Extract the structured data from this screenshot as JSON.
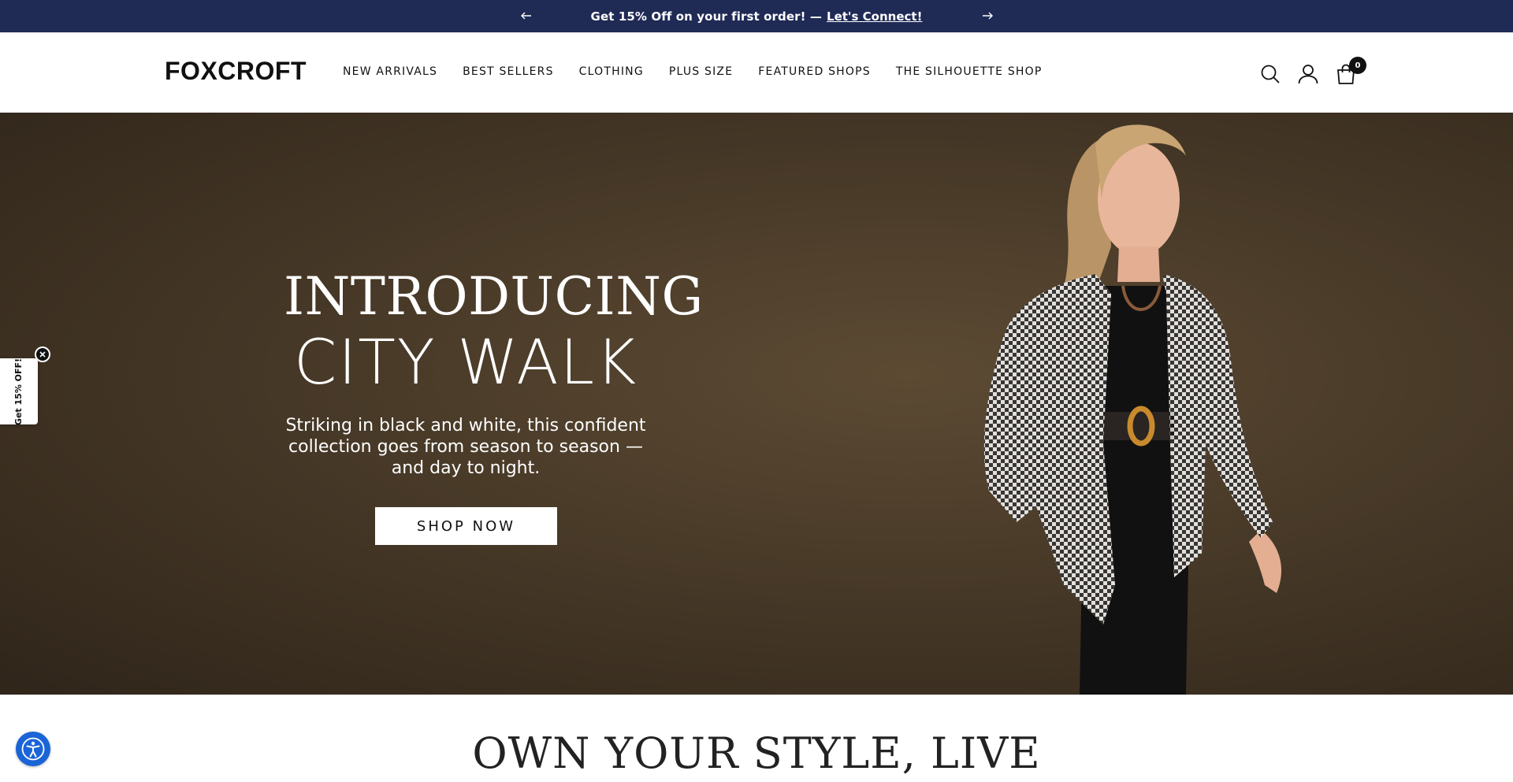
{
  "announcement": {
    "message": "Get 15% Off on your first order! —",
    "link": "Let's Connect!",
    "prev_icon": "arrow-left-icon",
    "next_icon": "arrow-right-icon",
    "background": "#1f2a55"
  },
  "header": {
    "logo": "FOXCROFT",
    "nav": [
      {
        "label": "NEW ARRIVALS"
      },
      {
        "label": "BEST SELLERS"
      },
      {
        "label": "CLOTHING"
      },
      {
        "label": "PLUS SIZE"
      },
      {
        "label": "FEATURED SHOPS"
      },
      {
        "label": "THE SILHOUETTE SHOP"
      }
    ],
    "icons": [
      "search-icon",
      "account-icon",
      "cart-icon"
    ],
    "cart_count": "0"
  },
  "hero": {
    "heading_line1": "INTRODUCING",
    "heading_line2": "CITY WALK",
    "subtitle": "Striking in black and white, this confident collection goes from season to season — and day to night.",
    "cta": "SHOP NOW"
  },
  "promo_tab": {
    "label": "Get 15% OFF!"
  },
  "accessibility": {
    "icon": "accessibility-icon",
    "color": "#1a64d6"
  },
  "section": {
    "headline": "OWN YOUR STYLE, LIVE"
  }
}
